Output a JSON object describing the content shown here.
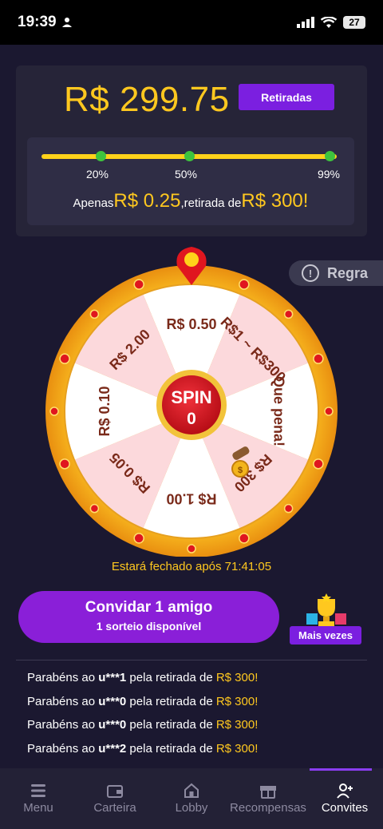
{
  "status": {
    "time": "19:39",
    "battery": "27"
  },
  "balance": {
    "amount": "R$ 299.75",
    "withdraw_label": "Retiradas"
  },
  "progress": {
    "value": 0.99,
    "markers": [
      {
        "label": "20%",
        "position": 0.2
      },
      {
        "label": "50%",
        "position": 0.5
      },
      {
        "label": "99%",
        "position": 0.99
      }
    ],
    "note_prefix": "Apenas",
    "note_remaining": "R$ 0.25",
    "note_middle": ",retirada de",
    "note_target": "R$ 300",
    "note_suffix": "!"
  },
  "rule_label": "Regra",
  "wheel": {
    "center_label": "SPIN",
    "center_count": "0",
    "segments": [
      {
        "label": "R$ 0.50",
        "color": "#ffffff"
      },
      {
        "label": "R$1 ~ R$300",
        "color": "#fcd9dc"
      },
      {
        "label": "Que pena!",
        "color": "#ffffff"
      },
      {
        "label": "R$ 300",
        "color": "#fcd9dc"
      },
      {
        "label": "R$ 1.00",
        "color": "#ffffff"
      },
      {
        "label": "R$ 0.05",
        "color": "#fcd9dc"
      },
      {
        "label": "R$ 0.10",
        "color": "#ffffff"
      },
      {
        "label": "R$ 2.00",
        "color": "#fcd9dc"
      }
    ]
  },
  "timer": "Estará fechado após 71:41:05",
  "invite": {
    "title": "Convidar 1 amigo",
    "subtitle": "1 sorteio disponível",
    "more_label": "Mais vezes"
  },
  "winners": [
    {
      "prefix": "Parabéns ao ",
      "user": "u***1",
      "middle": " pela retirada de ",
      "amount": "R$ 300",
      "suffix": "!"
    },
    {
      "prefix": "Parabéns ao ",
      "user": "u***0",
      "middle": " pela retirada de ",
      "amount": "R$ 300",
      "suffix": "!"
    },
    {
      "prefix": "Parabéns ao ",
      "user": "u***0",
      "middle": " pela retirada de ",
      "amount": "R$ 300",
      "suffix": "!"
    },
    {
      "prefix": "Parabéns ao ",
      "user": "u***2",
      "middle": " pela retirada de ",
      "amount": "R$ 300",
      "suffix": "!"
    }
  ],
  "tabs": [
    {
      "label": "Menu",
      "icon": "menu-icon"
    },
    {
      "label": "Carteira",
      "icon": "wallet-icon"
    },
    {
      "label": "Lobby",
      "icon": "home-icon"
    },
    {
      "label": "Recompensas",
      "icon": "gift-icon"
    },
    {
      "label": "Convites",
      "icon": "add-user-icon",
      "active": true
    }
  ],
  "colors": {
    "accent_purple": "#7b1fe0",
    "gold": "#ffc81f",
    "background": "#1b1830",
    "wheel_red": "#d8111d"
  }
}
